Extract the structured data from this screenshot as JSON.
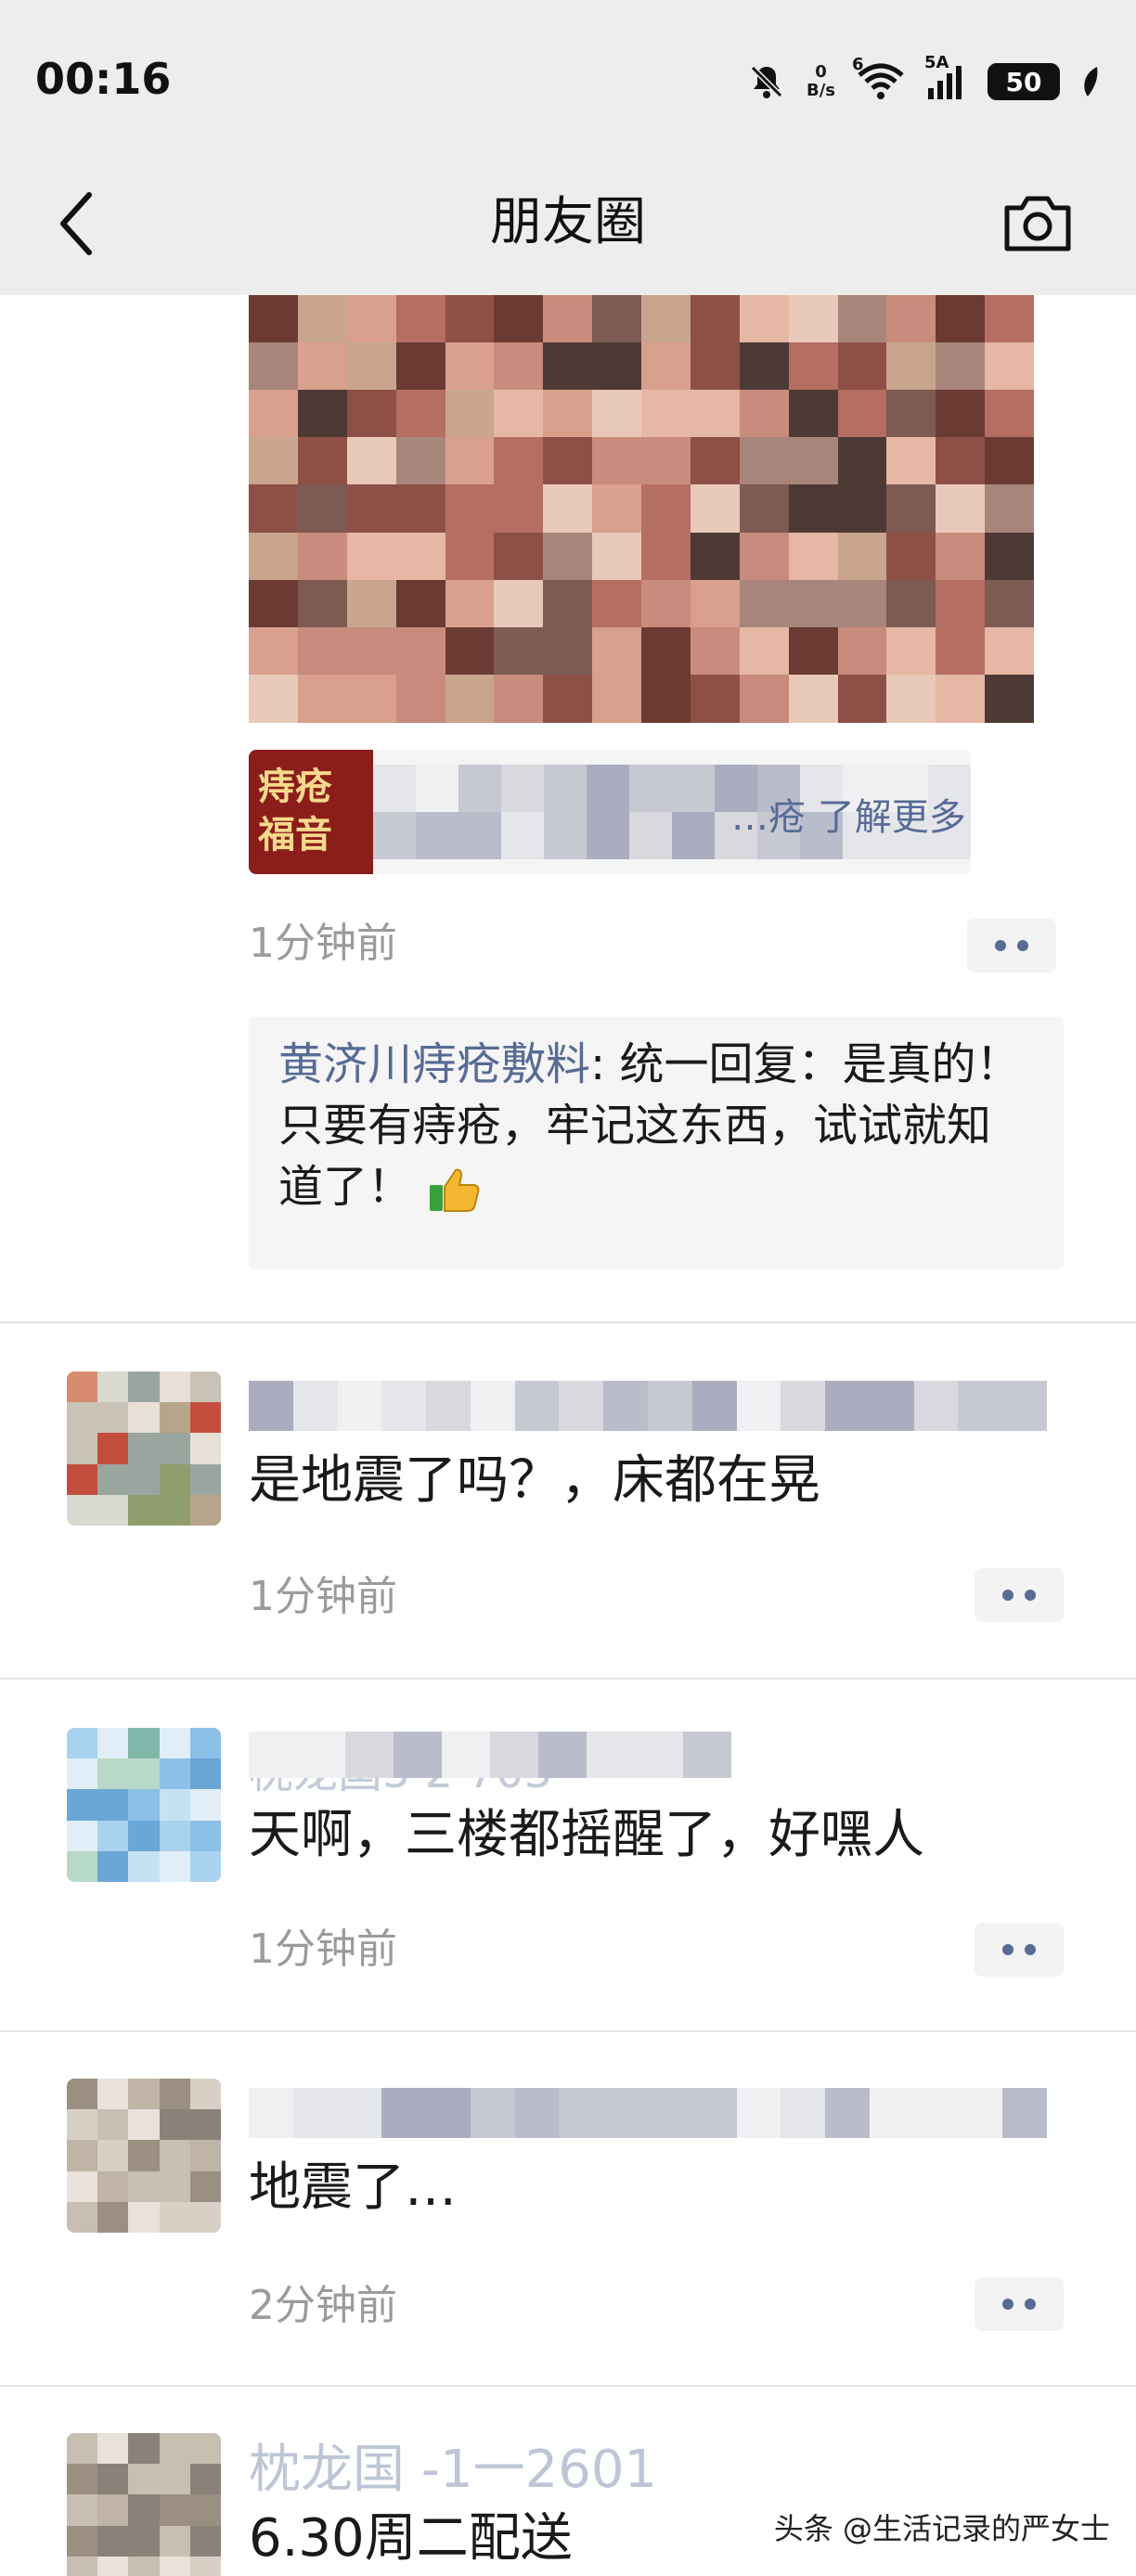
{
  "status_bar": {
    "time": "00:16",
    "net_speed_value": "0",
    "net_speed_unit": "B/s",
    "wifi_gen": "6",
    "signal_label": "5A",
    "battery": "50",
    "icons": [
      "mute-bell-icon",
      "wifi-icon",
      "signal-icon",
      "battery-icon",
      "leaf-icon"
    ]
  },
  "nav": {
    "title": "朋友圈",
    "back_icon": "chevron-left-icon",
    "camera_icon": "camera-icon"
  },
  "first_post": {
    "link_card": {
      "thumb_text": "痔疮福音",
      "text": "…疮 了解更多"
    },
    "time": "1分钟前",
    "comment": {
      "nickname": "黄济川痔疮敷料",
      "separator": ": ",
      "text": "统一回复：是真的！只要有痔疮，牢记这东西，试试就知道了！"
    }
  },
  "posts": [
    {
      "name": "…",
      "text": "是地震了吗？，床都在晃",
      "time": "1分钟前"
    },
    {
      "name": "枕龙国5 2 703",
      "text": "天啊，三楼都摇醒了，好嘿人",
      "time": "1分钟前"
    },
    {
      "name": "…",
      "text": "地震了…",
      "time": "2分钟前"
    },
    {
      "name": "枕龙国 -1一2601",
      "text": "6.30周二配送",
      "time": ""
    }
  ],
  "watermark": "头条 @生活记录的严女士",
  "colors": {
    "nav_bg": "#ededed",
    "link_blue": "#576b95",
    "time_gray": "#9b9b9b",
    "comment_bg": "#f5f5f5"
  }
}
